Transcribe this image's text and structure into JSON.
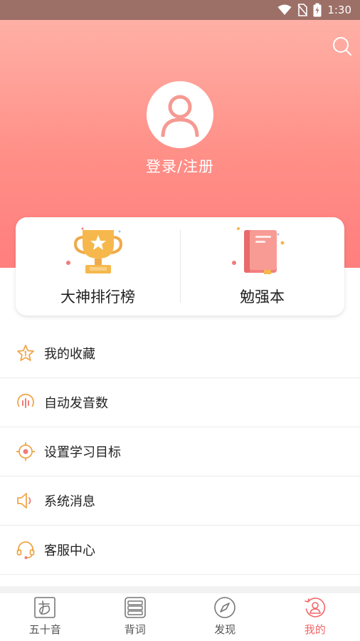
{
  "status_bar": {
    "time": "1:30"
  },
  "profile": {
    "login_label": "登录/注册"
  },
  "cards": [
    {
      "label": "大神排行榜",
      "icon": "trophy-icon"
    },
    {
      "label": "勉强本",
      "icon": "notebook-icon"
    }
  ],
  "menu": [
    {
      "label": "我的收藏",
      "icon": "star-icon"
    },
    {
      "label": "自动发音数",
      "icon": "sound-wave-icon"
    },
    {
      "label": "设置学习目标",
      "icon": "target-icon"
    },
    {
      "label": "系统消息",
      "icon": "speaker-icon"
    },
    {
      "label": "客服中心",
      "icon": "headset-icon"
    }
  ],
  "tabs": [
    {
      "label": "五十音",
      "icon": "kana-icon",
      "active": false
    },
    {
      "label": "背词",
      "icon": "cards-icon",
      "active": false
    },
    {
      "label": "发现",
      "icon": "compass-icon",
      "active": false
    },
    {
      "label": "我的",
      "icon": "profile-icon",
      "active": true
    }
  ],
  "colors": {
    "accent": "#f2676a",
    "icon_orange": "#f0a64a",
    "hero_top": "#ffb0a6",
    "hero_bottom": "#ff7e7e",
    "status_bar": "#9c6f67"
  }
}
